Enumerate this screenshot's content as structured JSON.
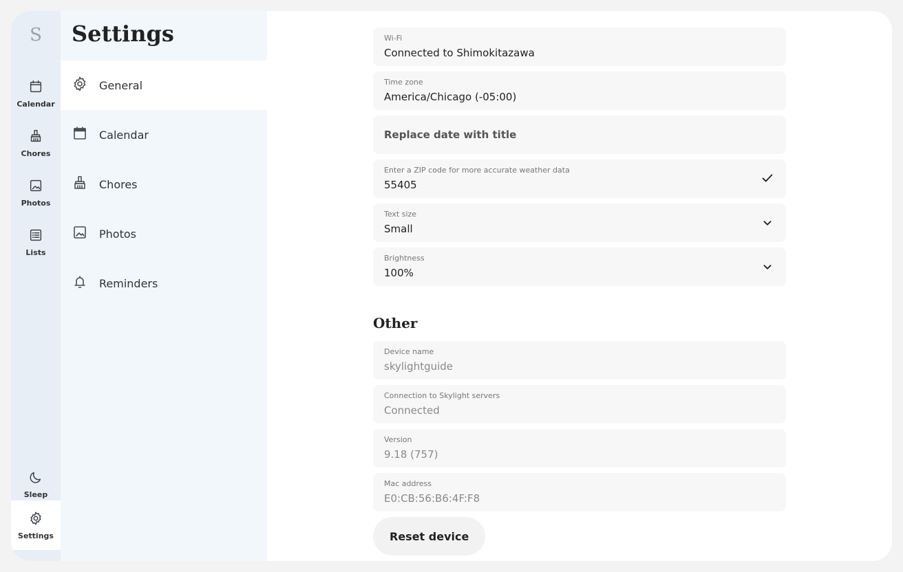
{
  "rail": {
    "logo": "S",
    "items": [
      {
        "label": "Calendar",
        "icon": "calendar-icon"
      },
      {
        "label": "Chores",
        "icon": "broom-icon"
      },
      {
        "label": "Photos",
        "icon": "photo-icon"
      },
      {
        "label": "Lists",
        "icon": "list-icon"
      },
      {
        "label": "Sleep",
        "icon": "moon-icon"
      },
      {
        "label": "Settings",
        "icon": "gear-icon"
      }
    ]
  },
  "sidebar": {
    "title": "Settings",
    "items": [
      {
        "label": "General",
        "icon": "gear-icon"
      },
      {
        "label": "Calendar",
        "icon": "calendar-icon"
      },
      {
        "label": "Chores",
        "icon": "broom-icon"
      },
      {
        "label": "Photos",
        "icon": "photo-icon"
      },
      {
        "label": "Reminders",
        "icon": "bell-icon"
      }
    ]
  },
  "general": {
    "wifi": {
      "label": "Wi-Fi",
      "value": "Connected to Shimokitazawa"
    },
    "timezone": {
      "label": "Time zone",
      "value": "America/Chicago (-05:00)"
    },
    "replace_date": {
      "value": "Replace date with title"
    },
    "zip": {
      "label": "Enter a ZIP code for more accurate weather data",
      "value": "55405"
    },
    "text_size": {
      "label": "Text size",
      "value": "Small"
    },
    "brightness": {
      "label": "Brightness",
      "value": "100%"
    }
  },
  "other": {
    "title": "Other",
    "device_name": {
      "label": "Device name",
      "value": "skylightguide"
    },
    "connection": {
      "label": "Connection to Skylight servers",
      "value": "Connected"
    },
    "version": {
      "label": "Version",
      "value": "9.18 (757)"
    },
    "mac": {
      "label": "Mac address",
      "value": "E0:CB:56:B6:4F:F8"
    },
    "reset_label": "Reset device"
  },
  "colors": {
    "rail_bg": "#e7eef6",
    "sidebar_bg": "#f2f7fb",
    "field_bg": "#f7f7f7"
  }
}
